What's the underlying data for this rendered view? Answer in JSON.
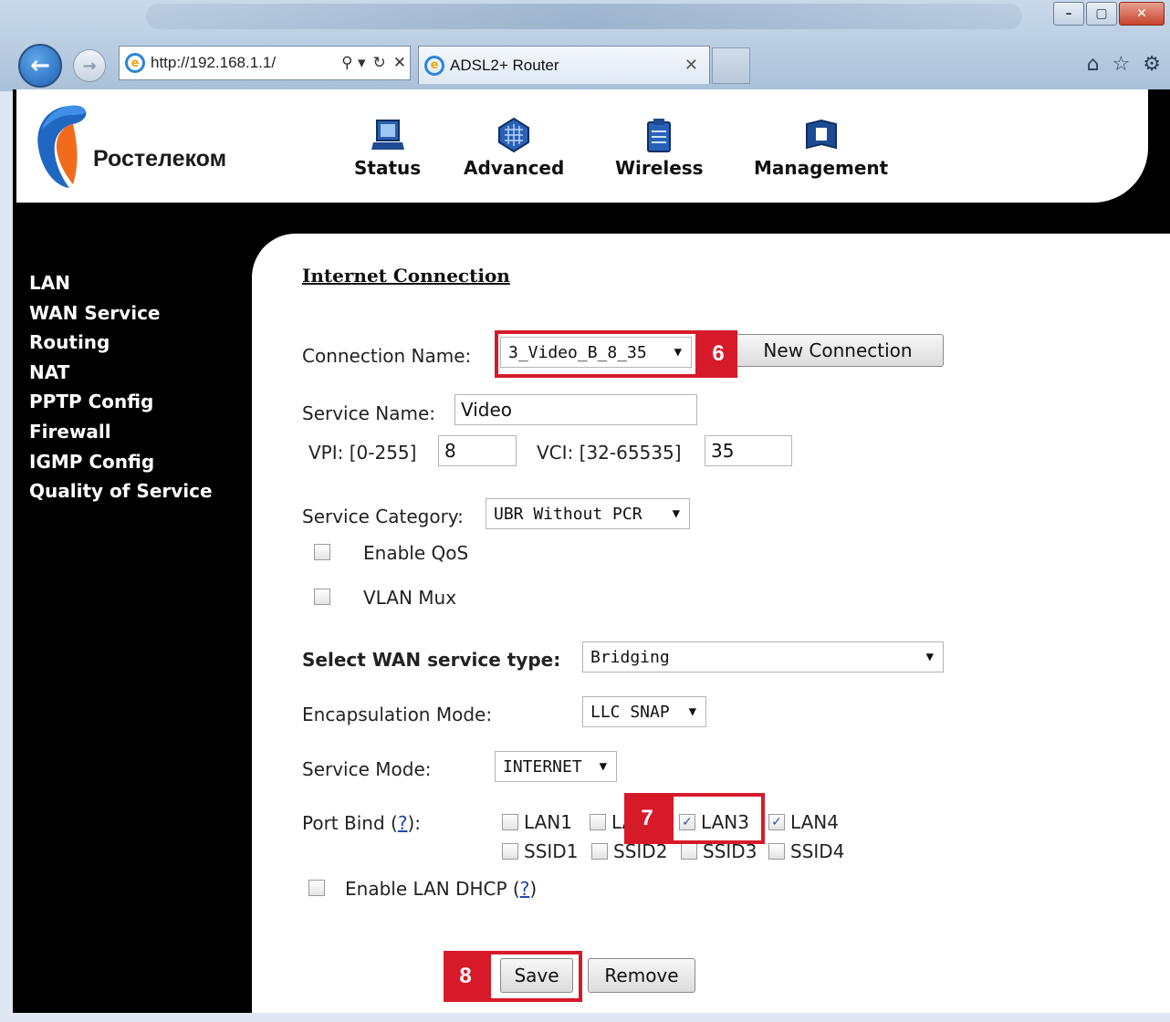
{
  "browser": {
    "address": "http://192.168.1.1/",
    "tab_title": "ADSL2+ Router",
    "address_controls": [
      "⚲ ▾",
      "↻",
      "✕"
    ]
  },
  "header": {
    "brand": "Ростелеком",
    "nav": [
      {
        "label": "Status",
        "icon": "laptop-icon"
      },
      {
        "label": "Advanced",
        "icon": "chip-icon"
      },
      {
        "label": "Wireless",
        "icon": "clipboard-icon"
      },
      {
        "label": "Management",
        "icon": "book-icon"
      }
    ]
  },
  "sidebar": {
    "items": [
      "LAN",
      "WAN Service",
      "Routing",
      "NAT",
      "PPTP Config",
      "Firewall",
      "IGMP Config",
      "Quality of Service"
    ]
  },
  "form": {
    "title": "Internet Connection",
    "connection_name_label": "Connection Name:",
    "connection_name_value": "3_Video_B_8_35",
    "new_connection_label": "New Connection",
    "service_name_label": "Service Name:",
    "service_name_value": "Video",
    "vpi_label": "VPI: [0-255]",
    "vpi_value": "8",
    "vci_label": "VCI: [32-65535]",
    "vci_value": "35",
    "service_category_label": "Service Category:",
    "service_category_value": "UBR Without PCR",
    "enable_qos_label": "Enable QoS",
    "enable_qos_checked": false,
    "vlan_mux_label": "VLAN Mux",
    "vlan_mux_checked": false,
    "wan_type_label": "Select WAN service type:",
    "wan_type_value": "Bridging",
    "encap_label": "Encapsulation Mode:",
    "encap_value": "LLC SNAP",
    "service_mode_label": "Service Mode:",
    "service_mode_value": "INTERNET",
    "port_bind_label": "Port Bind (",
    "port_bind_q": "?",
    "port_bind_close": "):",
    "ports": [
      {
        "label": "LAN1",
        "checked": false
      },
      {
        "label": "LAN2",
        "checked": false
      },
      {
        "label": "LAN3",
        "checked": true
      },
      {
        "label": "LAN4",
        "checked": true
      }
    ],
    "ssids": [
      {
        "label": "SSID1",
        "checked": false
      },
      {
        "label": "SSID2",
        "checked": false
      },
      {
        "label": "SSID3",
        "checked": false
      },
      {
        "label": "SSID4",
        "checked": false
      }
    ],
    "enable_dhcp_label": "Enable LAN DHCP (",
    "enable_dhcp_q": "?",
    "enable_dhcp_close": ")",
    "save_label": "Save",
    "remove_label": "Remove"
  },
  "annotations": {
    "step6": "6",
    "step7": "7",
    "step8": "8",
    "color": "#d61a2a"
  }
}
